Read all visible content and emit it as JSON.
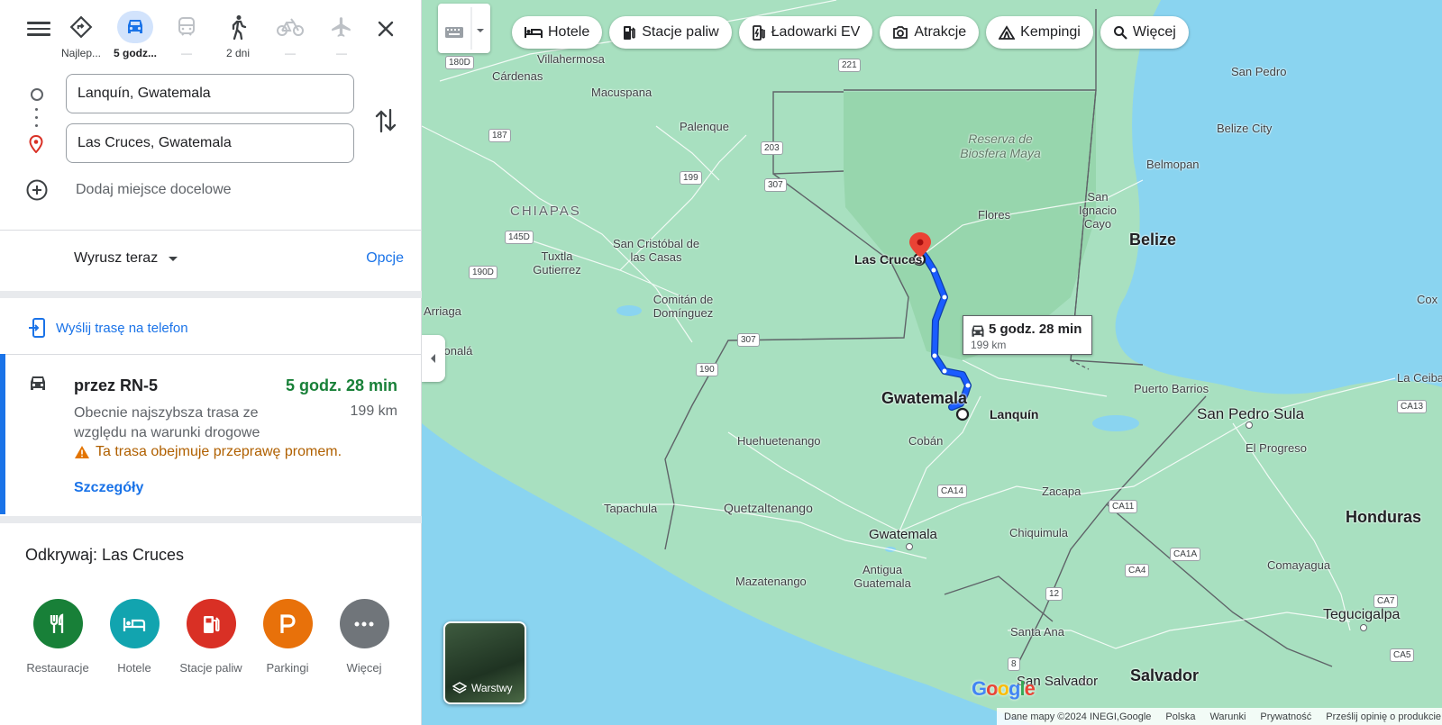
{
  "modes": [
    {
      "label": "Najlep..."
    },
    {
      "label": "5 godz..."
    },
    {
      "label": "—"
    },
    {
      "label": "2 dni"
    },
    {
      "label": "—"
    },
    {
      "label": "—"
    }
  ],
  "inputs": {
    "origin": "Lanquín, Gwatemala",
    "destination": "Las Cruces, Gwatemala",
    "add_destination": "Dodaj miejsce docelowe"
  },
  "depart": {
    "label": "Wyrusz teraz",
    "options": "Opcje"
  },
  "send_to_phone": "Wyślij trasę na telefon",
  "route": {
    "via": "przez RN-5",
    "duration": "5 godz. 28 min",
    "description": "Obecnie najszybsza trasa ze względu na warunki drogowe",
    "distance": "199 km",
    "warning": "Ta trasa obejmuje przeprawę promem.",
    "details": "Szczegóły"
  },
  "explore": {
    "title": "Odkrywaj: Las Cruces",
    "categories": [
      {
        "label": "Restauracje",
        "color": "#188038"
      },
      {
        "label": "Hotele",
        "color": "#12a4af"
      },
      {
        "label": "Stacje paliw",
        "color": "#d93025"
      },
      {
        "label": "Parkingi",
        "color": "#e8710a"
      },
      {
        "label": "Więcej",
        "color": "#70757a"
      }
    ]
  },
  "chips": [
    "Hotele",
    "Stacje paliw",
    "Ładowarki EV",
    "Atrakcje",
    "Kempingi",
    "Więcej"
  ],
  "map": {
    "labels": {
      "villahermosa": "Villahermosa",
      "cardenas": "Cárdenas",
      "macuspana": "Macuspana",
      "palenque": "Palenque",
      "chiapas": "CHIAPAS",
      "tuxtla": "Tuxtla Gutierrez",
      "sancristobal": "San Cristóbal de las Casas",
      "comitan": "Comitán de Domínguez",
      "arriaga": "Arriaga",
      "tonala": "Tonalá",
      "huehuetenango": "Huehuetenango",
      "tapachula": "Tapachula",
      "quetzaltenango": "Quetzaltenango",
      "mazatenango": "Mazatenango",
      "antigua": "Antigua Guatemala",
      "guatemala_city": "Gwatemala",
      "guatemala_country": "Gwatemala",
      "coban": "Cobán",
      "zacapa": "Zacapa",
      "chiquimula": "Chiquimula",
      "reserva": "Reserva de Biosfera Maya",
      "flores": "Flores",
      "lascruces": "Las Cruces",
      "lanquin": "Lanquín",
      "belize": "Belize",
      "belize_city": "Belize City",
      "belmopan": "Belmopan",
      "sanignacio": "San Ignacio Cayo",
      "sanpedro": "San Pedro",
      "puertobarrios": "Puerto Barrios",
      "sanpedrosula": "San Pedro Sula",
      "elprogreso": "El Progreso",
      "laceiba": "La Ceiba",
      "honduras": "Honduras",
      "comayagua": "Comayagua",
      "tegucigalpa": "Tegucigalpa",
      "santaana": "Santa Ana",
      "sansalvador": "San Salvador",
      "salvador": "Salvador",
      "cox": "Cox"
    },
    "shields": [
      "180D",
      "221",
      "187",
      "203",
      "199",
      "307",
      "145D",
      "190D",
      "307",
      "190",
      "CA14",
      "CA11",
      "CA13",
      "CA1A",
      "CA4",
      "CA7",
      "CA5",
      "12",
      "8"
    ],
    "duration_box": {
      "duration": "5 godz. 28 min",
      "distance": "199 km"
    },
    "layers": "Warstwy",
    "google": "Google",
    "footer": [
      "Dane mapy ©2024 INEGI,Google",
      "Polska",
      "Warunki",
      "Prywatność",
      "Prześlij opinię o produkcie"
    ]
  },
  "colors": {
    "accent": "#1a73e8",
    "route": "#1a5cff",
    "water": "#8ad4f0",
    "land": "#a8e0c0"
  }
}
